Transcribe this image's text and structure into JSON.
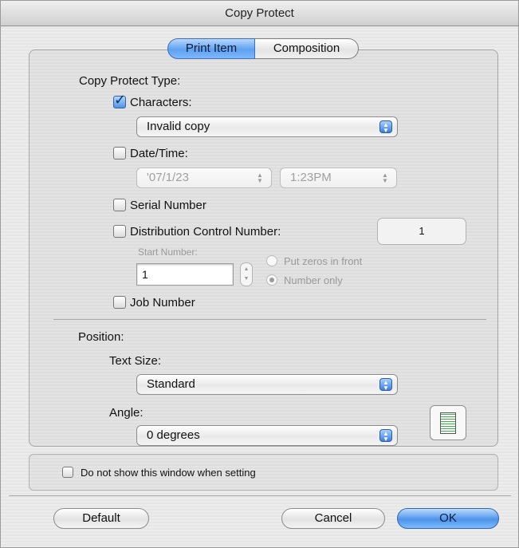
{
  "window": {
    "title": "Copy Protect"
  },
  "tabs": [
    {
      "label": "Print Item",
      "active": true
    },
    {
      "label": "Composition",
      "active": false
    }
  ],
  "copy_protect_type": {
    "heading": "Copy Protect Type:",
    "characters": {
      "label": "Characters:",
      "checked": true,
      "value": "Invalid copy"
    },
    "date_time": {
      "label": "Date/Time:",
      "checked": false,
      "date": "'07/1/23",
      "time": "1:23PM"
    },
    "serial_number": {
      "label": "Serial Number",
      "checked": false
    },
    "distribution_control": {
      "label": "Distribution Control Number:",
      "checked": false,
      "number_display": "1"
    },
    "start_number": {
      "label": "Start Number:",
      "value": "1",
      "options": [
        {
          "label": "Put zeros in front",
          "selected": false
        },
        {
          "label": "Number only",
          "selected": true
        }
      ]
    },
    "job_number": {
      "label": "Job Number",
      "checked": false
    }
  },
  "position": {
    "heading": "Position:",
    "text_size": {
      "label": "Text Size:",
      "value": "Standard"
    },
    "angle": {
      "label": "Angle:",
      "value": "0 degrees"
    },
    "preview_icon": "page-preview-icon"
  },
  "footer_option": {
    "label": "Do not show this window when setting",
    "checked": false
  },
  "buttons": {
    "default": "Default",
    "cancel": "Cancel",
    "ok": "OK"
  },
  "colors": {
    "accent": "#5ea1f0",
    "primary_button": "#4f93ea"
  }
}
